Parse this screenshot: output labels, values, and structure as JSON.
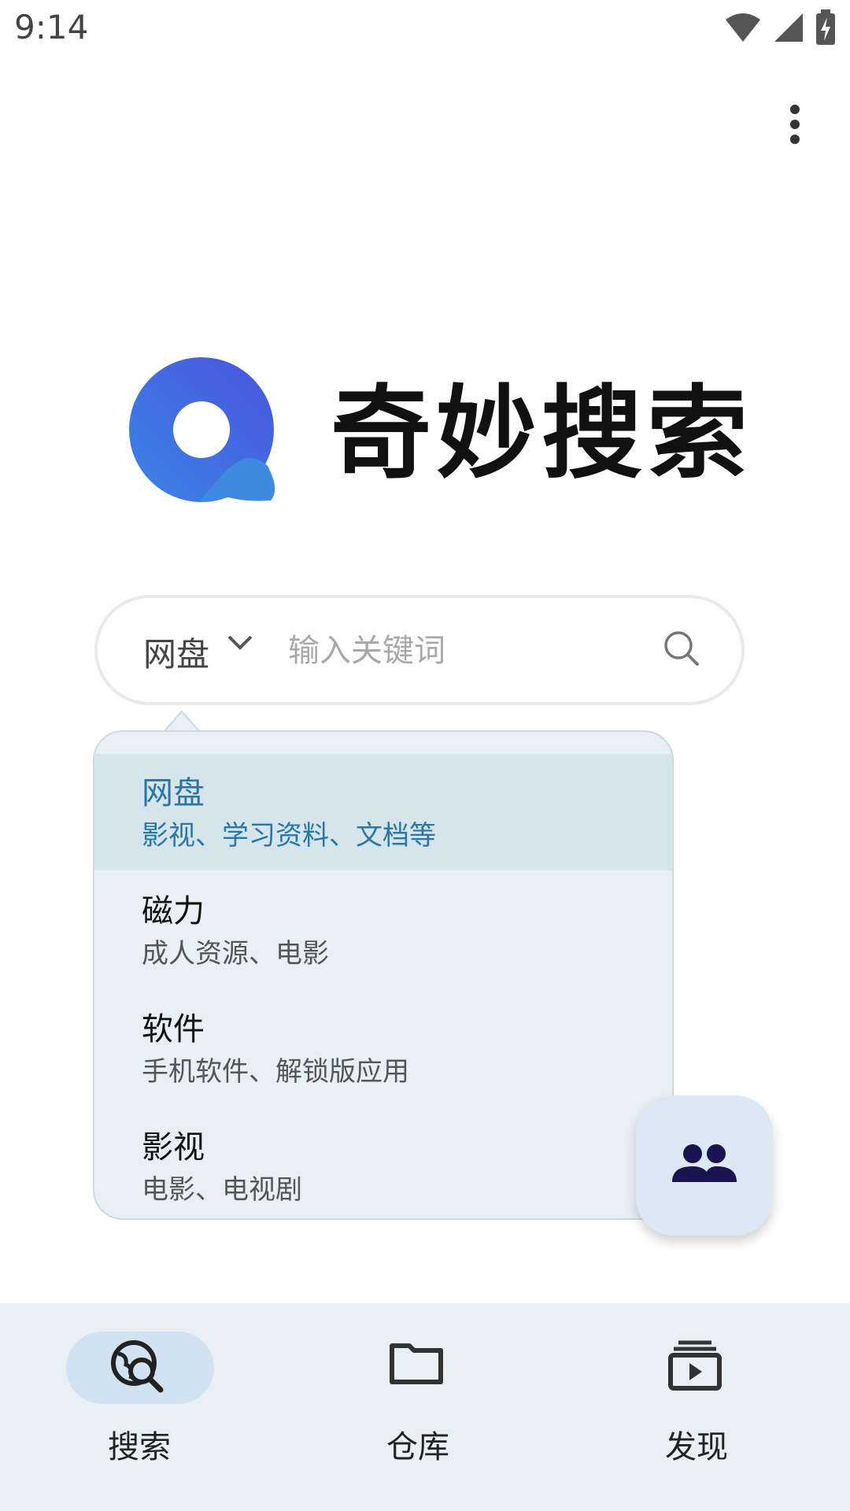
{
  "status_bar": {
    "time": "9:14",
    "icons": [
      "wifi-icon",
      "signal-icon",
      "battery-charging-icon"
    ]
  },
  "toolbar": {
    "more_icon": "more-vertical-icon"
  },
  "app": {
    "title": "奇妙搜索",
    "logo_colors": [
      "#3b7be3",
      "#4a5fe0"
    ]
  },
  "search": {
    "type_selected": "网盘",
    "placeholder": "输入关键词",
    "value": ""
  },
  "dropdown": {
    "items": [
      {
        "title": "网盘",
        "subtitle": "影视、学习资料、文档等",
        "selected": true
      },
      {
        "title": "磁力",
        "subtitle": "成人资源、电影",
        "selected": false
      },
      {
        "title": "软件",
        "subtitle": "手机软件、解锁版应用",
        "selected": false
      },
      {
        "title": "影视",
        "subtitle": "电影、电视剧",
        "selected": false
      }
    ]
  },
  "fab": {
    "icon": "group-icon",
    "color": "#1a1451"
  },
  "bottom_nav": {
    "items": [
      {
        "label": "搜索",
        "icon": "search-globe-icon",
        "active": true
      },
      {
        "label": "仓库",
        "icon": "folder-icon",
        "active": false
      },
      {
        "label": "发现",
        "icon": "video-library-icon",
        "active": false
      }
    ]
  },
  "colors": {
    "accent": "#2a76a6",
    "dropdown_bg": "#e8eff5",
    "selected_bg": "#d6e4ec",
    "nav_bg": "#e8eff5",
    "nav_active_pill": "#d1e2f0"
  }
}
